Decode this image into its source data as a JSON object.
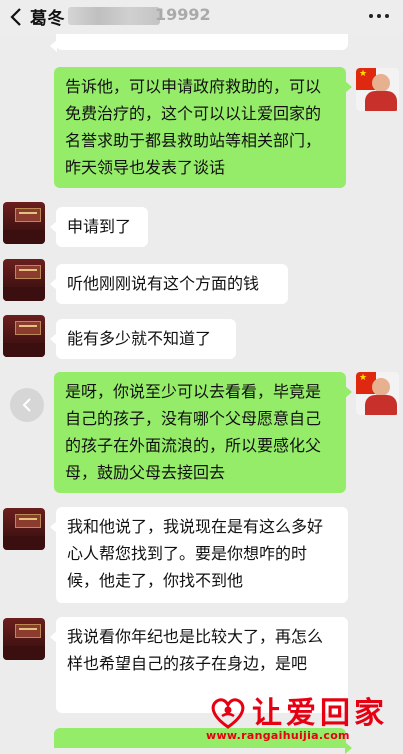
{
  "header": {
    "title": "葛冬",
    "title_suffix": "19992",
    "back_icon": "back-chevron-icon",
    "more_icon": "more-dots-icon"
  },
  "messages": [
    {
      "sender": "me",
      "text": "告诉他，可以申请政府救助的，可以免费治疗的，这个可以以让爱回家的名誉求助于都县救助站等相关部门，昨天领导也发表了谈话"
    },
    {
      "sender": "them",
      "text": "申请到了"
    },
    {
      "sender": "them",
      "text": "听他刚刚说有这个方面的钱"
    },
    {
      "sender": "them",
      "text": "能有多少就不知道了"
    },
    {
      "sender": "me",
      "text": "是呀，你说至少可以去看看，毕竟是自己的孩子，没有哪个父母愿意自己的孩子在外面流浪的，所以要感化父母，鼓励父母去接回去"
    },
    {
      "sender": "them",
      "text": "我和他说了，我说现在是有这么多好心人帮您找到了。要是你想咋的时候，他走了，你找不到他"
    },
    {
      "sender": "them",
      "text": "我说看你年纪也是比较大了，再怎么样也希望自己的孩子在身边，是吧"
    }
  ],
  "watermark": {
    "brand": "让爱回家",
    "url": "www.rangaihuijia.com",
    "logo_icon": "heart-hands-logo-icon",
    "color": "#e60012"
  },
  "colors": {
    "my_bubble": "#95ec69",
    "their_bubble": "#ffffff",
    "background": "#ececec"
  }
}
